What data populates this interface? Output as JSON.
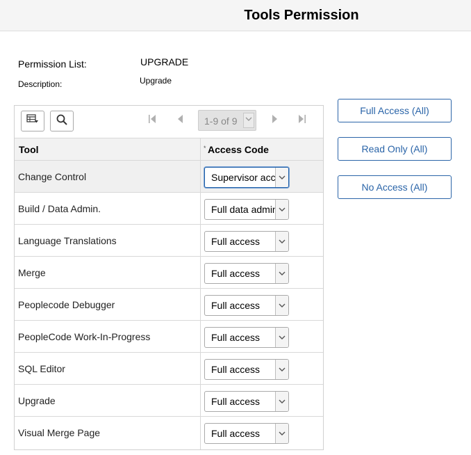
{
  "page": {
    "title": "Tools Permission"
  },
  "fields": {
    "permission_list_label": "Permission List:",
    "permission_list_value": "UPGRADE",
    "description_label": "Description:",
    "description_value": "Upgrade"
  },
  "grid": {
    "toolbar": {
      "personalize_icon": "grid-personalize-icon",
      "search_icon": "search-icon",
      "pager_text": "1-9 of 9"
    },
    "columns": {
      "tool": "Tool",
      "access_required_marker": "*",
      "access_code": "Access Code"
    },
    "rows": [
      {
        "tool": "Change Control",
        "access": "Supervisor access"
      },
      {
        "tool": "Build / Data Admin.",
        "access": "Full data admin"
      },
      {
        "tool": "Language Translations",
        "access": "Full access"
      },
      {
        "tool": "Merge",
        "access": "Full access"
      },
      {
        "tool": "Peoplecode Debugger",
        "access": "Full access"
      },
      {
        "tool": "PeopleCode Work-In-Progress",
        "access": "Full access"
      },
      {
        "tool": "SQL Editor",
        "access": "Full access"
      },
      {
        "tool": "Upgrade",
        "access": "Full access"
      },
      {
        "tool": "Visual Merge Page",
        "access": "Full access"
      }
    ]
  },
  "actions": {
    "full_access": "Full Access (All)",
    "read_only": "Read Only (All)",
    "no_access": "No Access (All)"
  },
  "colors": {
    "accent": "#2a64a8",
    "header_bg": "#f5f5f5",
    "grid_border": "#d0d0d0"
  }
}
